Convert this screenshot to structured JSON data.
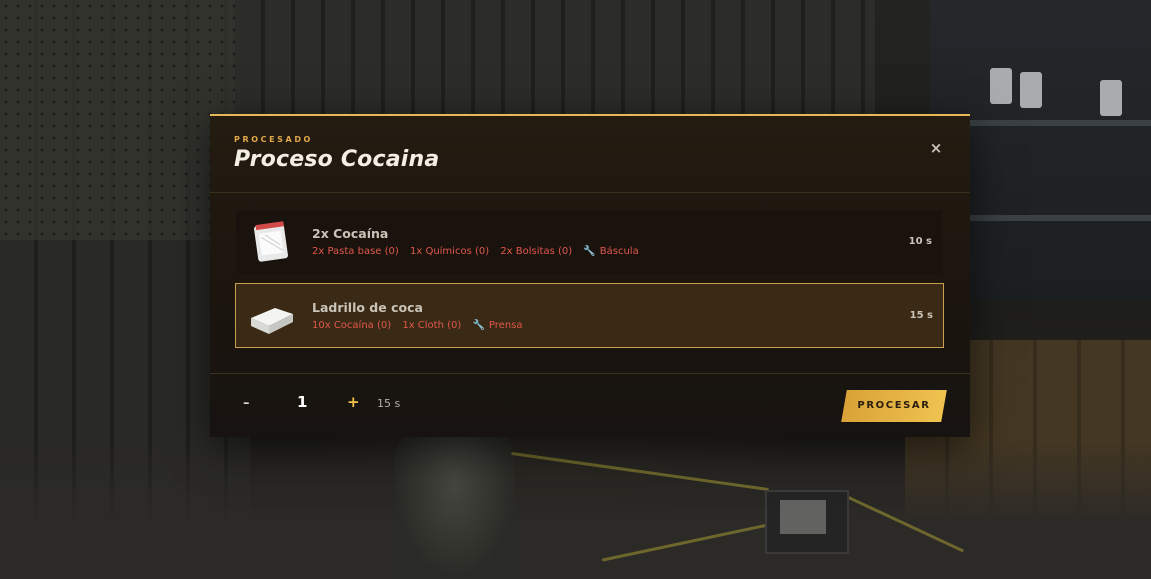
{
  "modal": {
    "kicker": "PROCESADO",
    "title": "Proceso Cocaina",
    "close_icon": "×",
    "accent_color": "#e6b756"
  },
  "recipes": [
    {
      "name": "2x Cocaína",
      "icon": "cocaine-bag-icon",
      "requirements": [
        "2x Pasta base (0)",
        "1x Químicos (0)",
        "2x Bolsitas (0)"
      ],
      "tool": "Báscula",
      "time": "10 s",
      "selected": false
    },
    {
      "name": "Ladrillo de coca",
      "icon": "coca-brick-icon",
      "requirements": [
        "10x Cocaína (0)",
        "1x Cloth (0)"
      ],
      "tool": "Prensa",
      "time": "15 s",
      "selected": true
    }
  ],
  "footer": {
    "minus": "–",
    "quantity": "1",
    "plus": "+",
    "total_time": "15 s",
    "process_button": "PROCESAR"
  }
}
